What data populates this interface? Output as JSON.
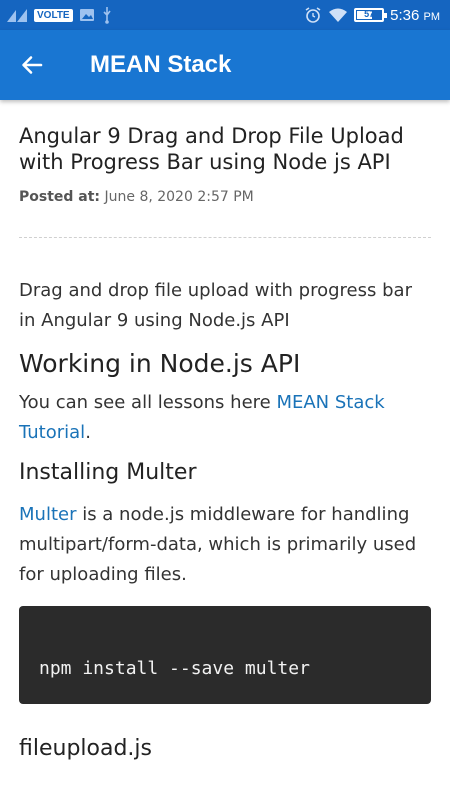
{
  "status_bar": {
    "volte_badge": "VOLTE",
    "battery_percent": "57",
    "battery_level": 0.57,
    "time": "5:36",
    "ampm": "PM",
    "icons": [
      "signal-icon",
      "image-icon",
      "usb-icon",
      "alarm-icon",
      "wifi-icon",
      "battery-icon"
    ]
  },
  "app_bar": {
    "title": "MEAN Stack",
    "back_icon": "arrow-left-icon"
  },
  "article": {
    "title": "Angular 9 Drag and Drop File Upload with Progress Bar using Node js API",
    "posted_label": "Posted at:",
    "posted_date": "June 8, 2020 2:57 PM",
    "intro": "Drag and drop file upload with progress bar in Angular 9 using Node.js API",
    "section1_heading": "Working in Node.js API",
    "lessons_prefix": "You can see all lessons here ",
    "lessons_link": "MEAN Stack Tutorial",
    "lessons_suffix": ".",
    "section2_heading": "Installing Multer",
    "multer_link": "Multer",
    "multer_text": " is a node.js middleware for handling multipart/form-data, which is primarily used for uploading files.",
    "code": "npm install --save multer",
    "section3_heading": "fileupload.js"
  },
  "colors": {
    "status_bar": "#1565c0",
    "app_bar": "#1976d2",
    "link": "#1a73b8",
    "code_bg": "#2b2b2b"
  }
}
